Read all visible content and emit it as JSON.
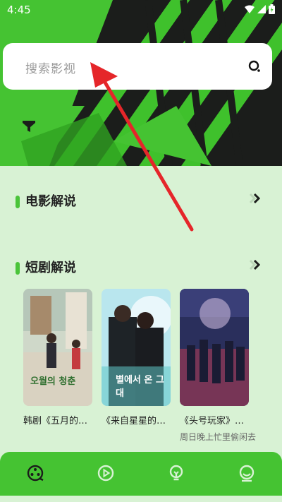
{
  "status_bar": {
    "time": "4:45"
  },
  "search": {
    "placeholder": "搜索影视"
  },
  "sections": [
    {
      "title": "电影解说"
    },
    {
      "title": "短剧解说"
    }
  ],
  "cards": [
    {
      "title": "韩剧《五月的…",
      "subtitle": "",
      "poster_text": "오월의 청춘"
    },
    {
      "title": "《来自星星的…",
      "subtitle": "",
      "poster_text": "별에서 온 그대"
    },
    {
      "title": "《头号玩家》…",
      "subtitle": "周日晚上忙里偷闲去",
      "poster_text": ""
    }
  ],
  "tabs": [
    {
      "icon": "film-reel-icon",
      "active": true
    },
    {
      "icon": "play-circle-icon",
      "active": false
    },
    {
      "icon": "lightbulb-icon",
      "active": false
    },
    {
      "icon": "profile-icon",
      "active": false
    }
  ],
  "colors": {
    "brand_green": "#45c332",
    "content_bg": "#d8f2d4",
    "arrow_red": "#e5262a"
  }
}
